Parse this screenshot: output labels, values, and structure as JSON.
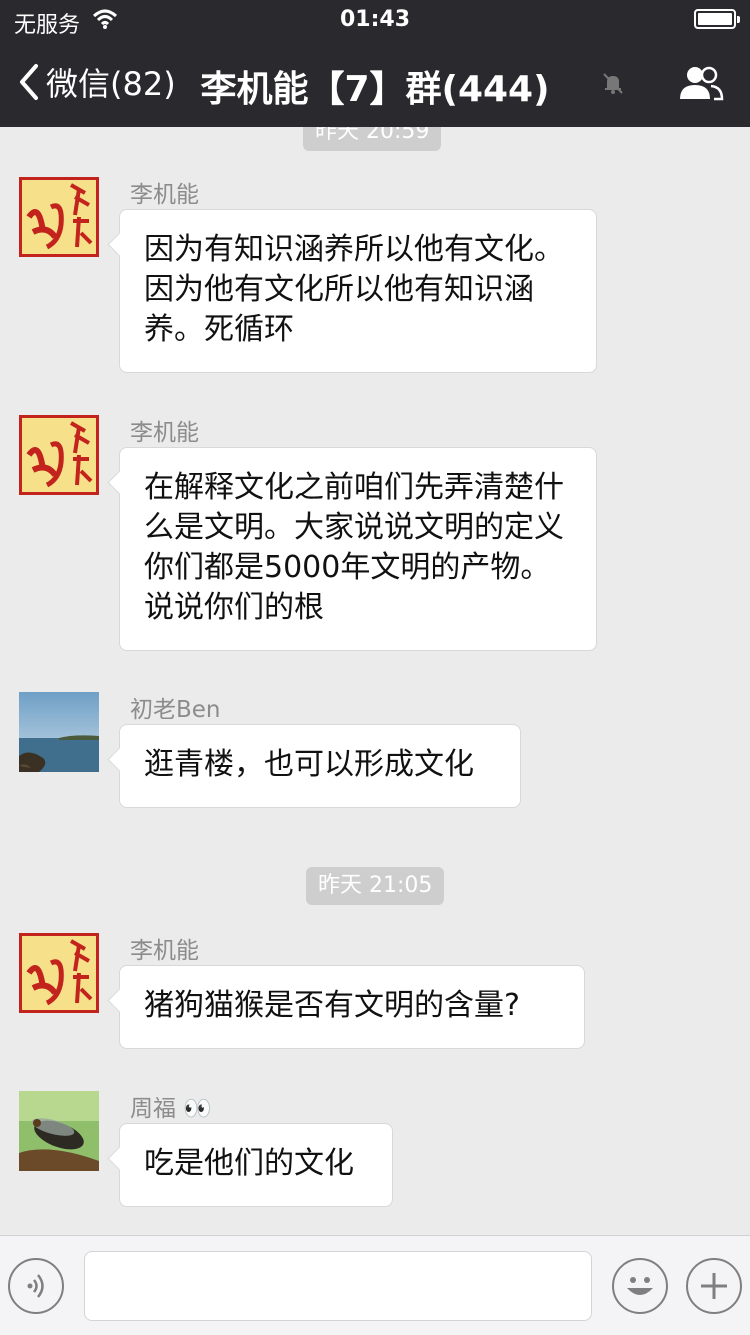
{
  "status_bar": {
    "carrier": "无服务",
    "time": "01:43",
    "battery_level": 1.0
  },
  "nav": {
    "back_label": "微信(82)",
    "title": "李机能【7】群(444)",
    "icons": [
      "chevron-left-icon",
      "mute-bell-icon",
      "group-members-icon"
    ]
  },
  "timestamps": [
    {
      "label": "昨天 20:59"
    },
    {
      "label": "昨天 21:05"
    }
  ],
  "messages": [
    {
      "sender": "李机能",
      "avatar": "red-calligraphy-avatar",
      "text": "因为有知识涵养所以他有文化。因为他有文化所以他有知识涵养。死循环"
    },
    {
      "sender": "李机能",
      "avatar": "red-calligraphy-avatar",
      "text": "在解释文化之前咱们先弄清楚什么是文明。大家说说文明的定义  你们都是5000年文明的产物。说说你们的根"
    },
    {
      "sender": "初老Ben",
      "avatar": "seaside-photo-avatar",
      "text": "逛青楼，也可以形成文化"
    },
    {
      "sender": "李机能",
      "avatar": "red-calligraphy-avatar",
      "text": "猪狗猫猴是否有文明的含量?"
    },
    {
      "sender": "周福 👀",
      "avatar": "cicada-photo-avatar",
      "text": "吃是他们的文化"
    }
  ],
  "input_bar": {
    "placeholder": "",
    "icons": [
      "voice-icon",
      "emoji-icon",
      "plus-icon"
    ]
  },
  "colors": {
    "nav_bg": "#2a2a2e",
    "chat_bg": "#ebebeb",
    "bubble_bg": "#ffffff",
    "time_pill_bg": "#cecece",
    "calligraphy_red": "#c3231d"
  }
}
